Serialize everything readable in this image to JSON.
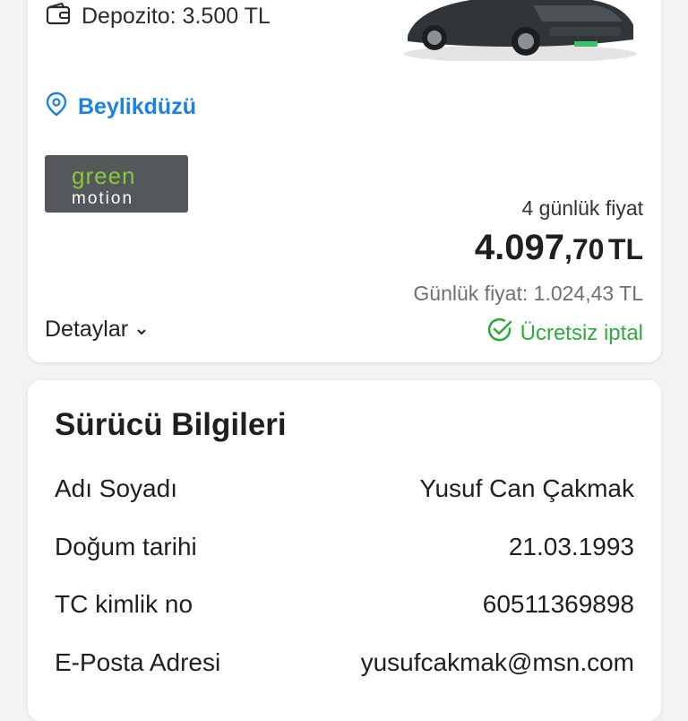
{
  "colors": {
    "link": "#1b82e0",
    "success": "#2eaa3f",
    "muted": "#707070"
  },
  "car_card": {
    "deposit_text": "Depozito: 3.500 TL",
    "location": "Beylikdüzü",
    "logo_text": "green motion",
    "price_caption": "4 günlük fiyat",
    "price_integer": "4.097",
    "price_decimal": ",70",
    "price_currency": "TL",
    "daily_price": "Günlük fiyat: 1.024,43 TL",
    "details_label": "Detaylar",
    "free_cancel_label": "Ücretsiz iptal"
  },
  "driver_card": {
    "title": "Sürücü Bilgileri",
    "rows": [
      {
        "label": "Adı Soyadı",
        "value": "Yusuf Can Çakmak"
      },
      {
        "label": "Doğum tarihi",
        "value": "21.03.1993"
      },
      {
        "label": "TC kimlik no",
        "value": "60511369898"
      },
      {
        "label": "E-Posta Adresi",
        "value": "yusufcakmak@msn.com"
      }
    ]
  }
}
